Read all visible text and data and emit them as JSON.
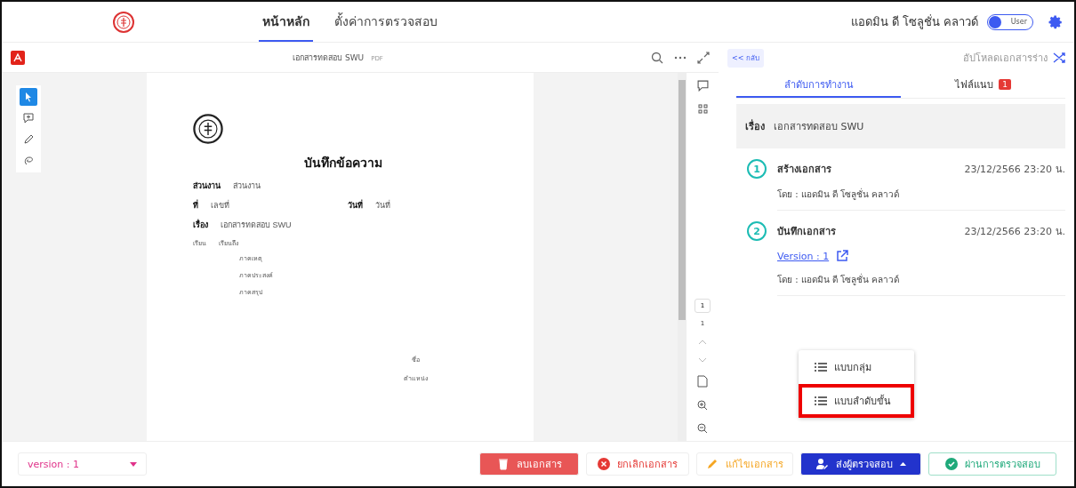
{
  "header": {
    "tabs": [
      {
        "label": "หน้าหลัก",
        "selected": true
      },
      {
        "label": "ตั้งค่าการตรวจสอบ",
        "selected": false
      }
    ],
    "user_name": "แอดมิน ดี โซลูชั่น คลาวด์",
    "role_toggle": {
      "label": "User",
      "on": true
    }
  },
  "viewer": {
    "title": "เอกสารทดสอบ SWU",
    "file_type": "PDF",
    "tools": [
      {
        "kind": "select",
        "selected": true
      },
      {
        "kind": "comment",
        "selected": false
      },
      {
        "kind": "draw",
        "selected": false
      },
      {
        "kind": "lasso",
        "selected": false
      }
    ],
    "page_current": "1",
    "page_total": "1"
  },
  "document": {
    "heading": "บันทึกข้อความ",
    "department": {
      "label": "ส่วนงาน",
      "value": "ส่วนงาน"
    },
    "number": {
      "label": "ที่",
      "value": "เลขที่"
    },
    "date": {
      "label": "วันที่",
      "value": "วันที่"
    },
    "subject": {
      "label": "เรื่อง",
      "value": "เอกสารทดสอบ SWU"
    },
    "to": {
      "label": "เรียน",
      "value": "เรียนถึง"
    },
    "paragraphs": [
      "ภาคเหตุ",
      "ภาคประสงค์",
      "ภาคสรุป"
    ],
    "signature": [
      "ชื่อ",
      "ตำแหน่ง"
    ]
  },
  "panel": {
    "back": "<< กลับ",
    "upload": "อัปโหลดเอกสารร่าง",
    "tabs": [
      {
        "label": "ลำดับการทำงาน",
        "selected": true
      },
      {
        "label": "ไฟล์แนบ",
        "badge": "1",
        "selected": false
      }
    ],
    "subject": {
      "label": "เรื่อง",
      "value": "เอกสารทดสอบ SWU"
    },
    "steps": [
      {
        "number": "1",
        "title": "สร้างเอกสาร",
        "time": "23/12/2566 23:20 น.",
        "by": "โดย : แอดมิน ดี โซลูชั่น คลาวด์"
      },
      {
        "number": "2",
        "title": "บันทึกเอกสาร",
        "time": "23/12/2566 23:20 น.",
        "link": "Version : 1",
        "by": "โดย : แอดมิน ดี โซลูชั่น คลาวด์"
      }
    ]
  },
  "menu": {
    "items": [
      {
        "label": "แบบกลุ่ม",
        "selected": false
      },
      {
        "label": "แบบลำดับขั้น",
        "selected": true
      }
    ]
  },
  "footer": {
    "version": "version : 1",
    "buttons": [
      {
        "kind": "delete",
        "label": "ลบเอกสาร"
      },
      {
        "kind": "cancel",
        "label": "ยกเลิกเอกสาร"
      },
      {
        "kind": "edit",
        "label": "แก้ไขเอกสาร"
      },
      {
        "kind": "send",
        "label": "ส่งผู้ตรวจสอบ"
      },
      {
        "kind": "approve",
        "label": "ผ่านการตรวจสอบ"
      }
    ]
  }
}
